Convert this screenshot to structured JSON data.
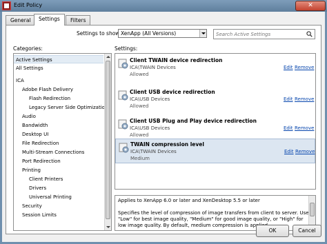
{
  "window": {
    "title": "Edit Policy",
    "close_glyph": "✕"
  },
  "tabs": [
    {
      "label": "General"
    },
    {
      "label": "Settings"
    },
    {
      "label": "Filters"
    }
  ],
  "filter": {
    "show_label": "Settings to show:",
    "show_value": "XenApp (All Versions)",
    "search_placeholder": "Search Active Settings"
  },
  "categories": {
    "label": "Categories:",
    "items": [
      {
        "label": "Active Settings"
      },
      {
        "label": "All Settings"
      },
      {
        "label": "ICA"
      },
      {
        "label": "Adobe Flash Delivery"
      },
      {
        "label": "Flash Redirection"
      },
      {
        "label": "Legacy Server Side Optimizations"
      },
      {
        "label": "Audio"
      },
      {
        "label": "Bandwidth"
      },
      {
        "label": "Desktop UI"
      },
      {
        "label": "File Redirection"
      },
      {
        "label": "Multi-Stream Connections"
      },
      {
        "label": "Port Redirection"
      },
      {
        "label": "Printing"
      },
      {
        "label": "Client Printers"
      },
      {
        "label": "Drivers"
      },
      {
        "label": "Universal Printing"
      },
      {
        "label": "Security"
      },
      {
        "label": "Session Limits"
      }
    ]
  },
  "settings": {
    "label": "Settings:",
    "edit_label": "Edit",
    "remove_label": "Remove",
    "items": [
      {
        "name": "Client TWAIN device redirection",
        "path": "ICA\\TWAIN Devices",
        "status": "Allowed"
      },
      {
        "name": "Client USB device redirection",
        "path": "ICA\\USB Devices",
        "status": "Allowed"
      },
      {
        "name": "Client USB Plug and Play device redirection",
        "path": "ICA\\USB Devices",
        "status": "Allowed"
      },
      {
        "name": "TWAIN compression level",
        "path": "ICA\\TWAIN Devices",
        "status": "Medium"
      }
    ]
  },
  "description": {
    "line1": "Applies to XenApp 6.0 or later and XenDesktop 5.5 or later",
    "line2": "Specifies the level of compression of image transfers from client to server. Use \"Low\" for best image quality, \"Medium\" for good image quality, or \"High\" for low image quality. By default, medium compression is applied."
  },
  "buttons": {
    "ok": "OK",
    "cancel": "Cancel"
  }
}
